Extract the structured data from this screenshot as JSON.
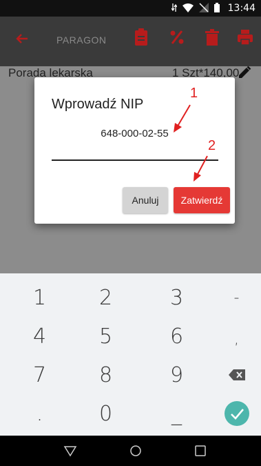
{
  "status_bar": {
    "time": "13:44"
  },
  "app_bar": {
    "title": "PARAGON",
    "icons": [
      "back-arrow-icon",
      "clipboard-icon",
      "percent-icon",
      "trash-icon",
      "printer-icon"
    ]
  },
  "item": {
    "name": "Porada lekarska",
    "quantity_price": "1 Szt*140,00"
  },
  "dialog": {
    "title": "Wprowadź NIP",
    "nip_value": "648-000-02-55",
    "cancel_label": "Anuluj",
    "confirm_label": "Zatwierdź"
  },
  "annotations": {
    "marker_1": "1",
    "marker_2": "2"
  },
  "keyboard": {
    "rows": [
      [
        "1",
        "2",
        "3",
        "-"
      ],
      [
        "4",
        "5",
        "6",
        ","
      ],
      [
        "7",
        "8",
        "9",
        "backspace-icon"
      ],
      [
        ".",
        "0",
        "_",
        "confirm-check-icon"
      ]
    ]
  },
  "colors": {
    "accent": "#e53935",
    "check": "#4db6ac",
    "app_bar": "#3a3a3a"
  }
}
